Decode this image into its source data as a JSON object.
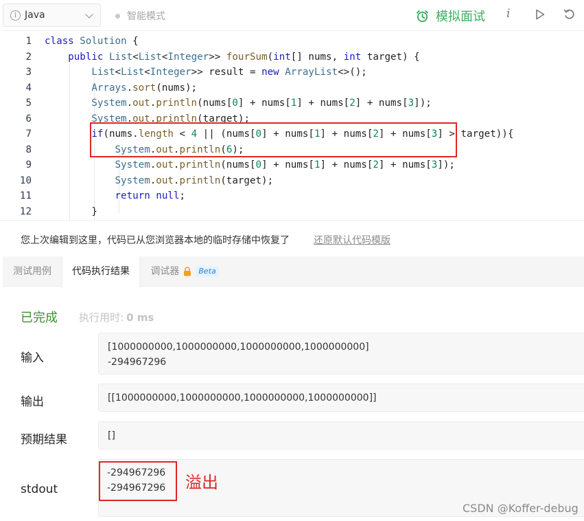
{
  "toolbar": {
    "language": "Java",
    "mode": "智能模式",
    "interview_label": "模拟面试",
    "colors": {
      "accent_green": "#3cad5c"
    },
    "icons": [
      "info-icon",
      "chevron-down-icon",
      "alarm-clock-icon",
      "info-italic-icon",
      "play-icon",
      "reset-icon"
    ]
  },
  "editor": {
    "line_numbers": [
      "1",
      "2",
      "3",
      "4",
      "5",
      "6",
      "7",
      "8",
      "9",
      "10",
      "11",
      "12"
    ],
    "lines": [
      "class Solution {",
      "    public List<List<Integer>> fourSum(int[] nums, int target) {",
      "        List<List<Integer>> result = new ArrayList<>();",
      "        Arrays.sort(nums);",
      "        System.out.println(nums[0] + nums[1] + nums[2] + nums[3]);",
      "        System.out.println(target);",
      "        if(nums.length < 4 || (nums[0] + nums[1] + nums[2] + nums[3] > target)){",
      "            System.out.println(6);",
      "            System.out.println(nums[0] + nums[1] + nums[2] + nums[3]);",
      "            System.out.println(target);",
      "            return null;",
      "        }"
    ]
  },
  "restore": {
    "message": "您上次编辑到这里，代码已从您浏览器本地的临时存储中恢复了",
    "link": "还原默认代码模版"
  },
  "tabs": {
    "items": [
      "测试用例",
      "代码执行结果",
      "调试器"
    ],
    "active": "代码执行结果",
    "beta": "Beta"
  },
  "result": {
    "status": "已完成",
    "runtime_label": "执行用时:",
    "runtime_value": "0 ms",
    "input_label": "输入",
    "input_line1": "[1000000000,1000000000,1000000000,1000000000]",
    "input_line2": "-294967296",
    "output_label": "输出",
    "output_value": "[[1000000000,1000000000,1000000000,1000000000]]",
    "expected_label": "预期结果",
    "expected_value": "[]",
    "stdout_label": "stdout",
    "stdout_line1": "-294967296",
    "stdout_line2": "-294967296",
    "annotation": "溢出"
  },
  "watermark": "CSDN @Koffer-debug"
}
